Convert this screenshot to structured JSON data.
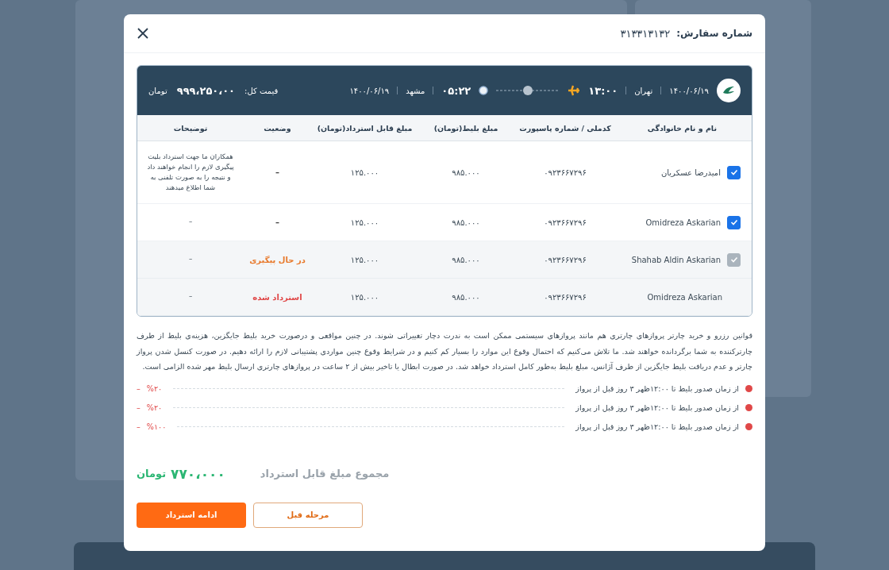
{
  "modal": {
    "order_label": "شماره سفارش:",
    "order_number": "۳۱۳۳۱۳۱۳۲"
  },
  "flight": {
    "depart_date": "۱۴۰۰/۰۶/۱۹",
    "origin": "تهران",
    "depart_time": "۱۳:۰۰",
    "arrive_time": "۰۵:۲۲",
    "destination": "مشهد",
    "arrive_date": "۱۴۰۰/۰۶/۱۹",
    "total_label": "قیمت کل:",
    "total_value": "۹۹۹،۲۵۰،۰۰",
    "total_currency": "تومان"
  },
  "table": {
    "columns": [
      "نام و نام خانوادگی",
      "کدملی / شماره پاسپورت",
      "مبلغ بلیط(تومان)",
      "مبلغ قابل استرداد(تومان)",
      "وضعیت",
      "توضیحات"
    ],
    "rows": [
      {
        "kind": "checkbox",
        "checked": true,
        "disabled": false,
        "name": "امیدرضا عسکریان",
        "passport": "۰۹۲۳۶۶۷۲۹۶",
        "ticket": "۹۸۵.۰۰۰",
        "refundable": "۱۲۵.۰۰۰",
        "status": "–",
        "color": "#444444",
        "notes": "همکاران ما جهت استرداد بلیت پیگیری لازم را انجام خواهند داد و نتیجه را به صورت تلفنی به شما اطلاع میدهند"
      },
      {
        "kind": "checkbox",
        "checked": true,
        "disabled": false,
        "name": "Omidreza Askarian",
        "passport": "۰۹۲۳۶۶۷۲۹۶",
        "ticket": "۹۸۵.۰۰۰",
        "refundable": "۱۲۵.۰۰۰",
        "status": "–",
        "color": "#444444",
        "notes": "–"
      },
      {
        "kind": "checkbox",
        "checked": true,
        "disabled": true,
        "name": "Shahab Aldin Askarian",
        "passport": "۰۹۲۳۶۶۷۲۹۶",
        "ticket": "۹۸۵.۰۰۰",
        "refundable": "۱۲۵.۰۰۰",
        "status": "در حال پیگیری",
        "color": "#e8782a",
        "notes": "–"
      },
      {
        "kind": "plain",
        "disabled": true,
        "name": "Omidreza Askarian",
        "passport": "۰۹۲۳۶۶۷۲۹۶",
        "ticket": "۹۸۵.۰۰۰",
        "refundable": "۱۲۵.۰۰۰",
        "status": "استرداد شده",
        "color": "#e04848",
        "notes": "–"
      }
    ]
  },
  "rules_text": "قوانین رزرو و خرید چارتر پروازهای چارتری هم مانند پروازهای سیستمی ممکن است به ندرت دچار تغییراتی شوند. در چنین مواقعی و درصورت خرید بلیط جایگزین، هزینه‌ی بلیط از طرف چارترکننده به شما برگردانده خواهند شد. ما تلاش می‌کنیم که احتمال وقوع این موارد را بسیار کم کنیم و در شرایط وقوع چنین مواردی پشتیبانی لازم را ارائه دهیم. در صورت کنسل شدن پرواز چارتر و عدم دریافت بلیط جایگزین از طرف آژانس، مبلغ بلیط به‌طور کامل استرداد خواهد شد. در صورت ابطال یا تاخیر بیش از ۲ ساعت در پروازهای چارتری ارسال بلیط مهر شده الزامی است.",
  "penalties": [
    {
      "text": "از زمان صدور بلیط تا ۱۲:۰۰ظهر ۳ روز قبل از پرواز",
      "penalty": "%۲۰",
      "sign": "–"
    },
    {
      "text": "از زمان صدور بلیط تا ۱۲:۰۰ظهر ۳ روز قبل از پرواز",
      "penalty": "%۲۰",
      "sign": "–"
    },
    {
      "text": "از زمان صدور بلیط تا ۱۲:۰۰ظهر ۳ روز قبل از پرواز",
      "penalty": "%۱۰۰",
      "sign": "–"
    }
  ],
  "summary": {
    "label": "مجموع مبلغ قابل استرداد",
    "amount": "۷۷۰،۰۰۰",
    "currency": "تومان"
  },
  "buttons": {
    "back": "مرحله قبل",
    "continue": "ادامه استرداد"
  }
}
